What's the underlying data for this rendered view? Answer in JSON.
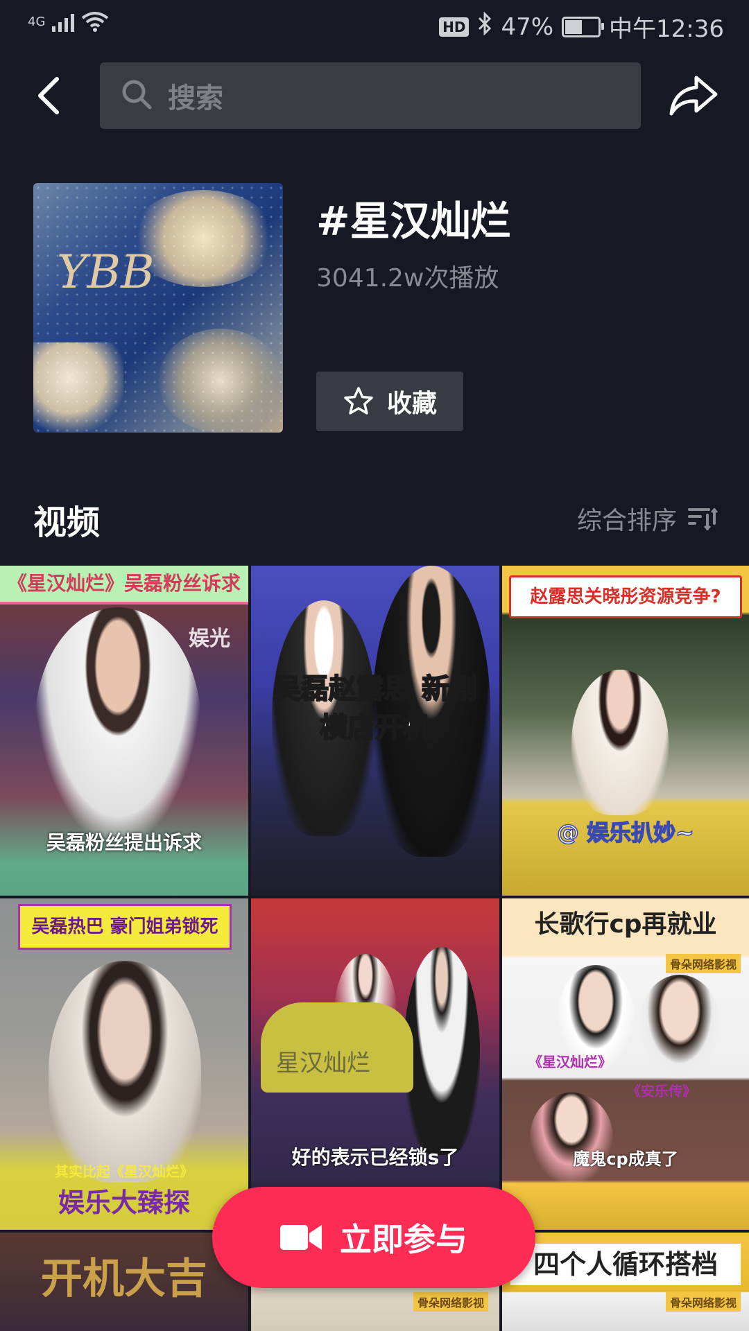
{
  "status_bar": {
    "network": "4G",
    "hd": "HD",
    "battery": "47%",
    "battery_level": 0.47,
    "time": "中午12:36"
  },
  "search": {
    "placeholder": "搜索"
  },
  "hashtag": {
    "title": "#星汉灿烂",
    "plays": "3041.2w次播放",
    "cover_monogram": "YBB",
    "collect_label": "收藏"
  },
  "videos": {
    "section_title": "视频",
    "sort_label": "综合排序",
    "items": [
      {
        "banner": "《星汉灿烂》吴磊粉丝诉求",
        "watermark": "娱光",
        "caption": "吴磊粉丝提出诉求"
      },
      {
        "caption": "吴磊赵露思 新剧横店开机"
      },
      {
        "banner": "赵露思关晓彤资源竞争?",
        "caption": "@ 娱乐扒妙~"
      },
      {
        "banner": "吴磊热巴 豪门姐弟锁死",
        "caption_small": "其实比起《星汉灿烂》",
        "caption": "娱乐大臻探"
      },
      {
        "prop_text": "星汉灿烂",
        "caption": "好的表示已经锁s了"
      },
      {
        "banner": "长歌行cp再就业",
        "source": "骨朵网络影视",
        "tag1": "《星汉灿烂》",
        "tag2": "《安乐传》",
        "caption": "魔鬼cp成真了"
      },
      {
        "banner": "开机大吉"
      },
      {
        "source": "骨朵网络影视"
      },
      {
        "banner": "四个人循环搭档",
        "source": "骨朵网络影视"
      }
    ]
  },
  "cta": {
    "label": "立即参与"
  },
  "colors": {
    "background": "#161823",
    "accent": "#fe2c55",
    "muted_text": "#8a8b92"
  }
}
